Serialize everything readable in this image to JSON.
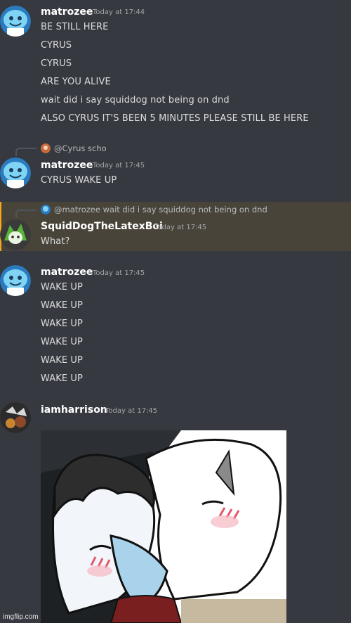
{
  "colors": {
    "background": "#36393f",
    "mention_highlight": "#48443a",
    "mention_border": "#faa61a",
    "username": "#ffffff",
    "text": "#dcddde",
    "timestamp": "#a3a6aa"
  },
  "messages": [
    {
      "username": "matrozee",
      "timestamp": "Today at 17:44",
      "avatar_icon": "cyan-smiley-avatar-icon",
      "lines": [
        "BE STILL HERE",
        "CYRUS",
        "CYRUS",
        "ARE YOU ALIVE",
        "wait did i say squiddog not being on dnd",
        "ALSO CYRUS IT'S BEEN 5 MINUTES PLEASE STILL BE HERE"
      ]
    },
    {
      "reply_to": "@Cyrus scho",
      "username": "matrozee",
      "timestamp": "Today at 17:45",
      "avatar_icon": "cyan-smiley-avatar-icon",
      "lines": [
        "CYRUS WAKE UP"
      ]
    },
    {
      "reply_to": "@matrozee wait did i say squiddog not being on dnd",
      "username": "SquidDogTheLatexBoi",
      "timestamp": "Today at 17:45",
      "avatar_icon": "green-character-avatar-icon",
      "lines": [
        "What?"
      ]
    },
    {
      "username": "matrozee",
      "timestamp": "Today at 17:45",
      "avatar_icon": "cyan-smiley-avatar-icon",
      "lines": [
        "WAKE UP",
        "WAKE UP",
        "WAKE UP",
        "WAKE UP",
        "WAKE UP",
        "WAKE UP"
      ]
    },
    {
      "username": "iamharrison",
      "timestamp": "Today at 17:45",
      "avatar_icon": "character-avatar-icon",
      "attachment_icon": "anime-art-image"
    }
  ],
  "watermark": "imgflip.com"
}
